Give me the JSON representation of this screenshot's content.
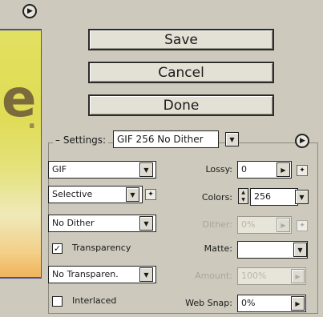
{
  "buttons": {
    "save": "Save",
    "cancel": "Cancel",
    "done": "Done"
  },
  "settings": {
    "label": "Settings:",
    "value": "GIF 256 No Dither"
  },
  "left_column": {
    "format": "GIF",
    "palette": "Selective",
    "dither_algorithm": "No Dither",
    "transparency_label": "Transparency",
    "transparency_checked": true,
    "transparency_dither": "No Transparen.",
    "interlaced_label": "Interlaced",
    "interlaced_checked": false
  },
  "right_column": {
    "lossy_label": "Lossy:",
    "lossy_value": "0",
    "colors_label": "Colors:",
    "colors_value": "256",
    "dither_label": "Dither:",
    "dither_value": "0%",
    "matte_label": "Matte:",
    "matte_value": "",
    "amount_label": "Amount:",
    "amount_value": "100%",
    "websnap_label": "Web Snap:",
    "websnap_value": "0%"
  },
  "icons": {
    "menu": "arrow-circle-icon",
    "dropdown": "chevron-down-icon",
    "wand": "wand-icon",
    "spinner": "spinner-arrows-icon"
  }
}
